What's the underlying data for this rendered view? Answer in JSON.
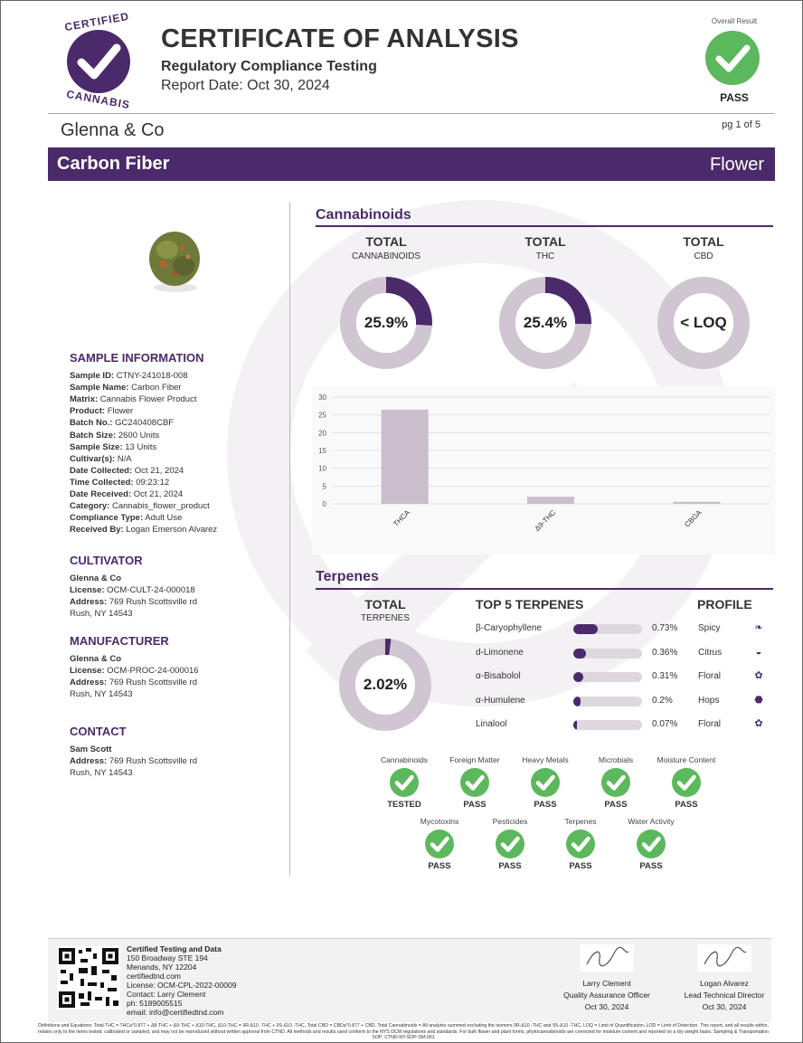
{
  "header": {
    "logo_word_top": "CERTIFIED",
    "logo_word_bottom": "CANNABIS",
    "title": "CERTIFICATE OF ANALYSIS",
    "subtitle": "Regulatory Compliance Testing",
    "report_date": "Report Date: Oct 30, 2024",
    "overall_result_label": "Overall Result",
    "overall_result": "PASS",
    "client": "Glenna & Co",
    "page": "pg 1 of 5",
    "product_name": "Carbon Fiber",
    "product_category": "Flower"
  },
  "colors": {
    "brand": "#4b2a6b",
    "pass": "#5cb85c",
    "bar": "#c9bfcb"
  },
  "sample": {
    "heading": "SAMPLE INFORMATION",
    "fields": [
      {
        "label": "Sample ID:",
        "value": " CTNY-241018-008"
      },
      {
        "label": "Sample Name:",
        "value": " Carbon Fiber"
      },
      {
        "label": "Matrix:",
        "value": " Cannabis Flower Product"
      },
      {
        "label": "Product:",
        "value": " Flower"
      },
      {
        "label": "Batch No.:",
        "value": " GC240408CBF"
      },
      {
        "label": "Batch Size:",
        "value": " 2600 Units"
      },
      {
        "label": "Sample Size:",
        "value": " 13 Units"
      },
      {
        "label": "Cultivar(s):",
        "value": " N/A"
      },
      {
        "label": "Date Collected:",
        "value": " Oct 21, 2024"
      },
      {
        "label": "Time Collected:",
        "value": " 09:23:12"
      },
      {
        "label": "Date Received:",
        "value": " Oct 21, 2024"
      },
      {
        "label": "Category:",
        "value": " Cannabis_flower_product"
      },
      {
        "label": "Compliance Type:",
        "value": " Adult Use"
      },
      {
        "label": "Received By:",
        "value": " Logan Emerson Alvarez"
      }
    ]
  },
  "cultivator": {
    "heading": "CULTIVATOR",
    "name": "Glenna & Co",
    "license_label": "License:",
    "license": " OCM-CULT-24-000018",
    "address_label": "Address:",
    "address": " 769 Rush Scottsville rd",
    "city": "Rush, NY 14543"
  },
  "manufacturer": {
    "heading": "MANUFACTURER",
    "name": "Glenna & Co",
    "license_label": "License:",
    "license": " OCM-PROC-24-000016",
    "address_label": "Address:",
    "address": " 769 Rush Scottsville rd",
    "city": "Rush, NY 14543"
  },
  "contact": {
    "heading": "CONTACT",
    "name": "Sam Scott",
    "address_label": "Address:",
    "address": " 769 Rush Scottsville rd",
    "city": "Rush, NY 14543"
  },
  "cannabinoids": {
    "heading": "Cannabinoids",
    "totals": [
      {
        "title": "TOTAL",
        "sub": "CANNABINOIDS",
        "display": "25.9%",
        "fraction": 0.259
      },
      {
        "title": "TOTAL",
        "sub": "THC",
        "display": "25.4%",
        "fraction": 0.254
      },
      {
        "title": "TOTAL",
        "sub": "CBD",
        "display": "< LOQ",
        "fraction": 0
      }
    ]
  },
  "chart_data": {
    "type": "bar",
    "categories": [
      "THCA",
      "Δ9-THC",
      "CBGA"
    ],
    "values": [
      26.5,
      2.0,
      0.6
    ],
    "ylim": [
      0,
      30
    ],
    "yticks": [
      0,
      5,
      10,
      15,
      20,
      25,
      30
    ],
    "grid": true
  },
  "terpenes": {
    "heading": "Terpenes",
    "total_title": "TOTAL",
    "total_sub": "TERPENES",
    "total_display": "2.02%",
    "total_fraction": 0.0202,
    "top_heading": "TOP 5 TERPENES",
    "profile_heading": "PROFILE",
    "items": [
      {
        "name": "β-Caryophyllene",
        "value": "0.73%",
        "fraction": 0.36,
        "profile": "Spicy",
        "icon": "pepper-icon",
        "glyph": "❧"
      },
      {
        "name": "d-Limonene",
        "value": "0.36%",
        "fraction": 0.18,
        "profile": "Citrus",
        "icon": "citrus-icon",
        "glyph": "◒"
      },
      {
        "name": "α-Bisabolol",
        "value": "0.31%",
        "fraction": 0.15,
        "profile": "Floral",
        "icon": "flower-icon",
        "glyph": "✿"
      },
      {
        "name": "α-Humulene",
        "value": "0.2%",
        "fraction": 0.1,
        "profile": "Hops",
        "icon": "hops-icon",
        "glyph": "⬣"
      },
      {
        "name": "Linalool",
        "value": "0.07%",
        "fraction": 0.04,
        "profile": "Floral",
        "icon": "flower-icon",
        "glyph": "✿"
      }
    ]
  },
  "tests": [
    {
      "label": "Cannabinoids",
      "status": "TESTED"
    },
    {
      "label": "Foreign Matter",
      "status": "PASS"
    },
    {
      "label": "Heavy Metals",
      "status": "PASS"
    },
    {
      "label": "Microbials",
      "status": "PASS"
    },
    {
      "label": "Moisture Content",
      "status": "PASS"
    },
    {
      "label": "Mycotoxins",
      "status": "PASS"
    },
    {
      "label": "Pesticides",
      "status": "PASS"
    },
    {
      "label": "Terpenes",
      "status": "PASS"
    },
    {
      "label": "Water Activity",
      "status": "PASS"
    }
  ],
  "footer": {
    "lab_name": "Certified Testing and Data",
    "lab_lines": [
      "150 Broadway STE 194",
      "Menands, NY 12204",
      "certifiedtnd.com",
      "License: OCM-CPL-2022-00009",
      "Contact: Larry Clement",
      "ph: 5189005515",
      "email: info@certifiedtnd.com"
    ],
    "signers": [
      {
        "name": "Larry Clement",
        "role": "Quality Assurance Officer",
        "date": "Oct 30, 2024"
      },
      {
        "name": "Logan Alvarez",
        "role": "Lead Technical Director",
        "date": "Oct 30, 2024"
      }
    ],
    "disclaimer": "Definitions and Equations: Total THC = THCa*0.877 + Δ8-THC + Δ9-THC + Δ10-THC, Δ10-THC = 9R-Δ10 -THC + 9S-Δ10 -THC, Total CBD = CBDa*0.877 + CBD, Total Cannabinoids = All analytes summed excluding the isomers 9R-Δ10 -THC and 9S-Δ10 -THC, LOQ = Limit of Quantification, LOD = Limit of Detection. This report, and all results within, relates only to the items tested, calibrated or sampled, and may not be reproduced without written approval from CTND. All methods and results used conform to the NYS OCM regulations and standards. For bulk flower and plant forms, phytocannabinoids are corrected for moisture content and reported on a dry weight basis. Sampling & Transportation SOP: CTND-NY-SOP-SM-001"
  }
}
